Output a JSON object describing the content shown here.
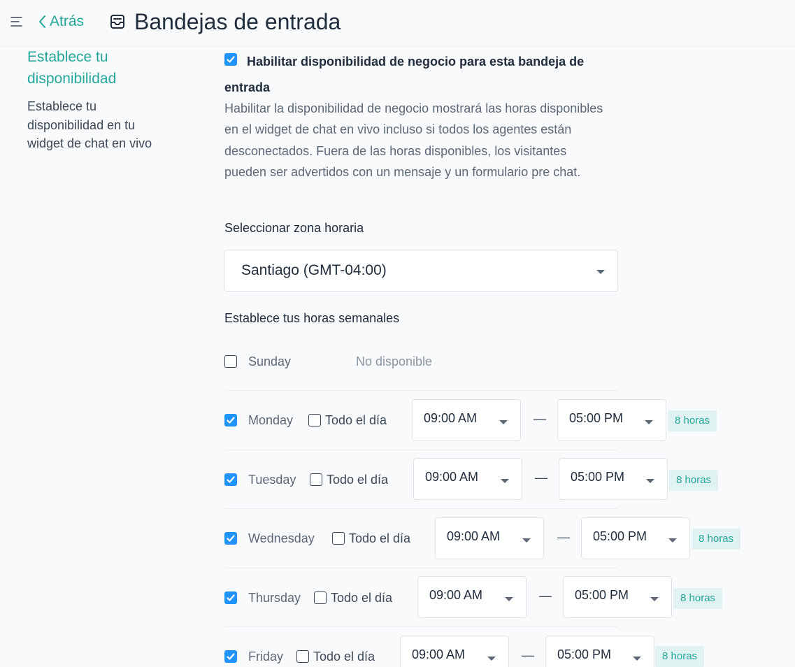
{
  "header": {
    "back_label": "Atrás",
    "title": "Bandejas de entrada"
  },
  "sidebar": {
    "title": "Establece tu disponibilidad",
    "description": "Establece tu disponibilidad en tu widget de chat en vivo"
  },
  "availability": {
    "enable_checked": true,
    "enable_label": "Habilitar disponibilidad de negocio para esta bandeja de entrada",
    "help_text": "Habilitar la disponibilidad de negocio mostrará las horas disponibles en el widget de chat en vivo incluso si todos los agentes están desconectados. Fuera de las horas disponibles, los visitantes pueden ser advertidos con un mensaje y un formulario pre chat."
  },
  "timezone": {
    "label": "Seleccionar zona horaria",
    "value": "Santiago (GMT-04:00)"
  },
  "weekly": {
    "label": "Establece tus horas semanales",
    "unavailable_text": "No disponible",
    "all_day_label": "Todo el día",
    "separator": "—",
    "days": [
      {
        "name": "Sunday",
        "enabled": false
      },
      {
        "name": "Monday",
        "enabled": true,
        "from": "09:00 AM",
        "to": "05:00 PM",
        "hours": "8 horas"
      },
      {
        "name": "Tuesday",
        "enabled": true,
        "from": "09:00 AM",
        "to": "05:00 PM",
        "hours": "8 horas"
      },
      {
        "name": "Wednesday",
        "enabled": true,
        "from": "09:00 AM",
        "to": "05:00 PM",
        "hours": "8 horas"
      },
      {
        "name": "Thursday",
        "enabled": true,
        "from": "09:00 AM",
        "to": "05:00 PM",
        "hours": "8 horas"
      },
      {
        "name": "Friday",
        "enabled": true,
        "from": "09:00 AM",
        "to": "05:00 PM",
        "hours": "8 horas"
      }
    ]
  },
  "colors": {
    "accent": "#26a69a",
    "checkbox": "#1f93ff",
    "badge_bg": "#e0f2f1"
  }
}
